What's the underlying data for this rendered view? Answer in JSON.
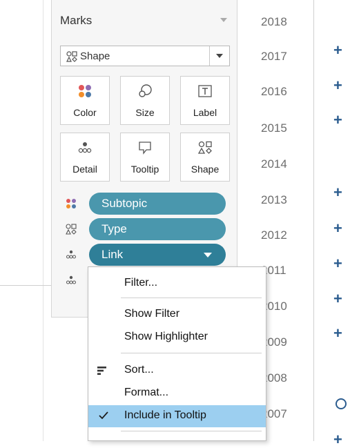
{
  "marks": {
    "title": "Marks",
    "mark_type": "Shape",
    "buttons": [
      {
        "label": "Color",
        "icon": "color-icon"
      },
      {
        "label": "Size",
        "icon": "size-icon"
      },
      {
        "label": "Label",
        "icon": "label-icon"
      },
      {
        "label": "Detail",
        "icon": "detail-icon"
      },
      {
        "label": "Tooltip",
        "icon": "tooltip-icon"
      },
      {
        "label": "Shape",
        "icon": "shape-icon"
      }
    ],
    "pills": [
      {
        "label": "Subtopic",
        "icon": "color-icon"
      },
      {
        "label": "Type",
        "icon": "shape-icon"
      },
      {
        "label": "Link",
        "icon": "detail-icon"
      }
    ]
  },
  "years": [
    "2018",
    "2017",
    "2016",
    "2015",
    "2014",
    "2013",
    "2012",
    "2011",
    "2010",
    "2009",
    "2008",
    "2007"
  ],
  "context_menu": {
    "items": [
      {
        "label": "Filter..."
      },
      {
        "label": "Show Filter"
      },
      {
        "label": "Show Highlighter"
      },
      {
        "label": "Sort...",
        "icon": "sort-icon"
      },
      {
        "label": "Format..."
      },
      {
        "label": "Include in Tooltip",
        "checked": true,
        "icon": "checkmark-icon"
      }
    ]
  },
  "colors": {
    "pill_teal": "#4a97ad",
    "pill_dark": "#2f7f98",
    "menu_selected": "#9ccff0",
    "mark_plus": "#2b5c8f"
  }
}
